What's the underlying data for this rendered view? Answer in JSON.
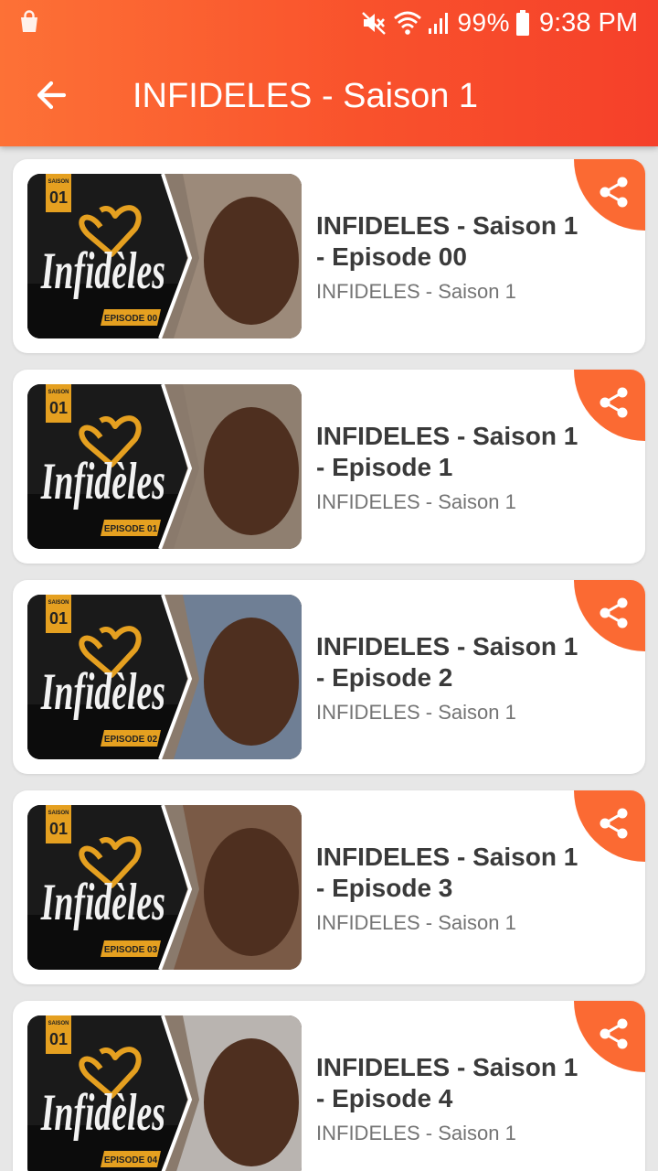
{
  "status_bar": {
    "battery": "99%",
    "time": "9:38 PM"
  },
  "header": {
    "title": "INFIDELES - Saison 1"
  },
  "episodes": [
    {
      "title": "INFIDELES - Saison 1 - Episode 00",
      "subtitle": "INFIDELES - Saison 1",
      "thumb_season": "01",
      "thumb_season_label": "SAISON",
      "thumb_logo": "Infidèles",
      "thumb_episode": "EPISODE 00"
    },
    {
      "title": "INFIDELES - Saison 1 - Episode 1",
      "subtitle": "INFIDELES - Saison 1",
      "thumb_season": "01",
      "thumb_season_label": "SAISON",
      "thumb_logo": "Infidèles",
      "thumb_episode": "EPISODE 01"
    },
    {
      "title": "INFIDELES - Saison 1 - Episode 2",
      "subtitle": "INFIDELES - Saison 1",
      "thumb_season": "01",
      "thumb_season_label": "SAISON",
      "thumb_logo": "Infidèles",
      "thumb_episode": "EPISODE 02"
    },
    {
      "title": "INFIDELES - Saison 1 - Episode 3",
      "subtitle": "INFIDELES - Saison 1",
      "thumb_season": "01",
      "thumb_season_label": "SAISON",
      "thumb_logo": "Infidèles",
      "thumb_episode": "EPISODE 03"
    },
    {
      "title": "INFIDELES - Saison 1 - Episode 4",
      "subtitle": "INFIDELES - Saison 1",
      "thumb_season": "01",
      "thumb_season_label": "SAISON",
      "thumb_logo": "Infidèles",
      "thumb_episode": "EPISODE 04"
    }
  ],
  "icons": {
    "status_left": "shopping-bag-icon",
    "mute": "mute-icon",
    "wifi": "wifi-icon",
    "signal": "signal-icon",
    "battery": "battery-icon",
    "back": "arrow-back-icon",
    "share": "share-icon"
  },
  "colors": {
    "accent": "#fb6a33",
    "header_gradient_start": "#fd7136",
    "header_gradient_end": "#f5402a",
    "logo_gold": "#e5a020",
    "background": "#e7e7e7"
  }
}
